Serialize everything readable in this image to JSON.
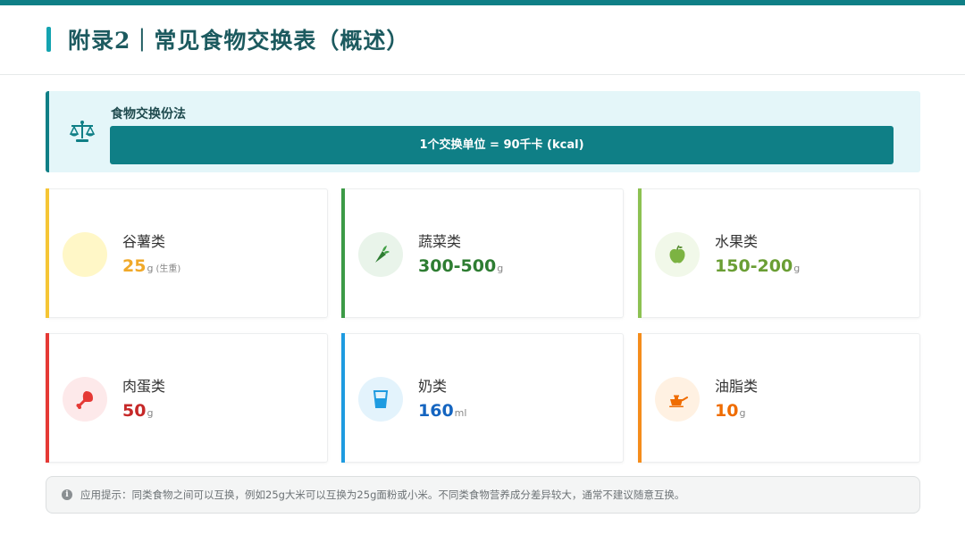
{
  "page": {
    "title": "附录2｜常见食物交换表（概述）"
  },
  "banner": {
    "icon": "balance-scale-icon",
    "title": "食物交换份法",
    "definition": "1个交换单位 = 90千卡 (kcal)"
  },
  "food_groups": [
    {
      "name": "谷薯类",
      "value": "25",
      "unit": "g",
      "note": "(生重)",
      "icon": "grain-circle-icon",
      "accent": "#f5c535",
      "value_color": "#f0a92a",
      "circle_bg": "#fff7c7"
    },
    {
      "name": "蔬菜类",
      "value": "300-500",
      "unit": "g",
      "icon": "carrot-icon",
      "accent": "#3c9a46",
      "value_color": "#2e7d32",
      "circle_bg": "#e9f4ea"
    },
    {
      "name": "水果类",
      "value": "150-200",
      "unit": "g",
      "icon": "apple-icon",
      "accent": "#8cc152",
      "value_color": "#6a9e34",
      "circle_bg": "#f1f8e9"
    },
    {
      "name": "肉蛋类",
      "value": "50",
      "unit": "g",
      "icon": "meat-leg-icon",
      "accent": "#e53935",
      "value_color": "#c62828",
      "circle_bg": "#fde9ea"
    },
    {
      "name": "奶类",
      "value": "160",
      "unit": "ml",
      "icon": "milk-glass-icon",
      "accent": "#1e9be0",
      "value_color": "#1565c0",
      "circle_bg": "#e3f3fc"
    },
    {
      "name": "油脂类",
      "value": "10",
      "unit": "g",
      "icon": "oil-pot-icon",
      "accent": "#f58c1b",
      "value_color": "#ef6c00",
      "circle_bg": "#fff1e2"
    }
  ],
  "tip": {
    "icon": "info-icon",
    "text": "应用提示：同类食物之间可以互换，例如25g大米可以互换为25g面粉或小米。不同类食物营养成分差异较大，通常不建议随意互换。"
  }
}
